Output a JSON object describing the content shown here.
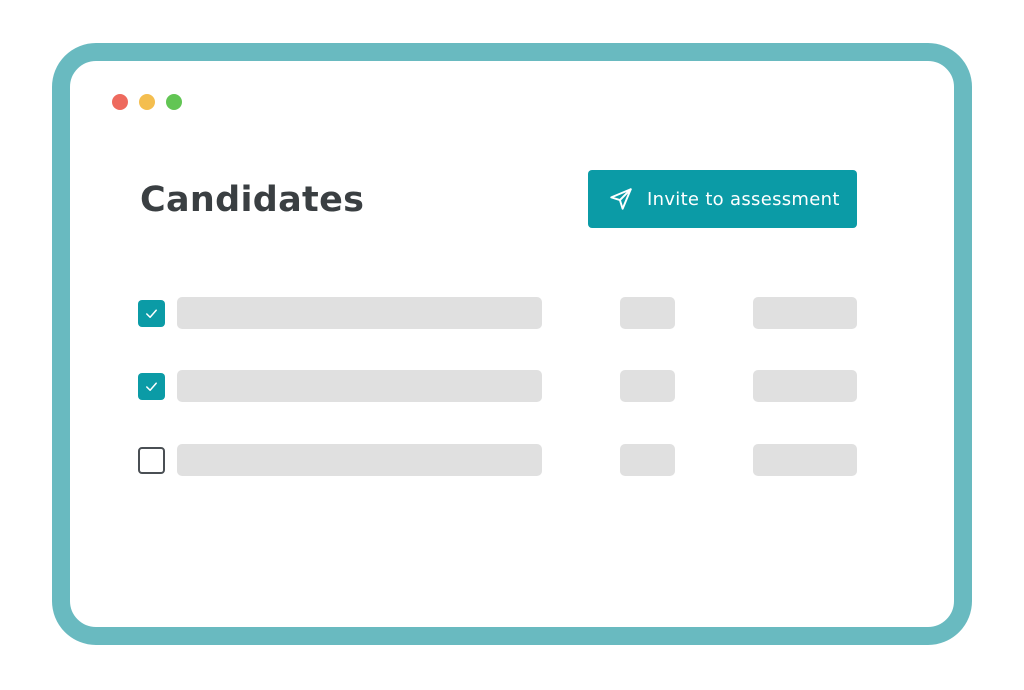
{
  "window": {
    "controls": [
      {
        "name": "close",
        "color": "#ee6a5e"
      },
      {
        "name": "minimize",
        "color": "#f4be4f"
      },
      {
        "name": "maximize",
        "color": "#62c554"
      }
    ],
    "frame_color": "#69bac0"
  },
  "page": {
    "title": "Candidates"
  },
  "invite_button": {
    "label": "Invite to assessment",
    "icon": "send-icon",
    "color": "#0b9ba6"
  },
  "candidates": {
    "placeholder_color": "#e0e0e0",
    "checkbox_color": "#0b9ba6",
    "rows": [
      {
        "checked": true
      },
      {
        "checked": true
      },
      {
        "checked": false
      }
    ]
  }
}
